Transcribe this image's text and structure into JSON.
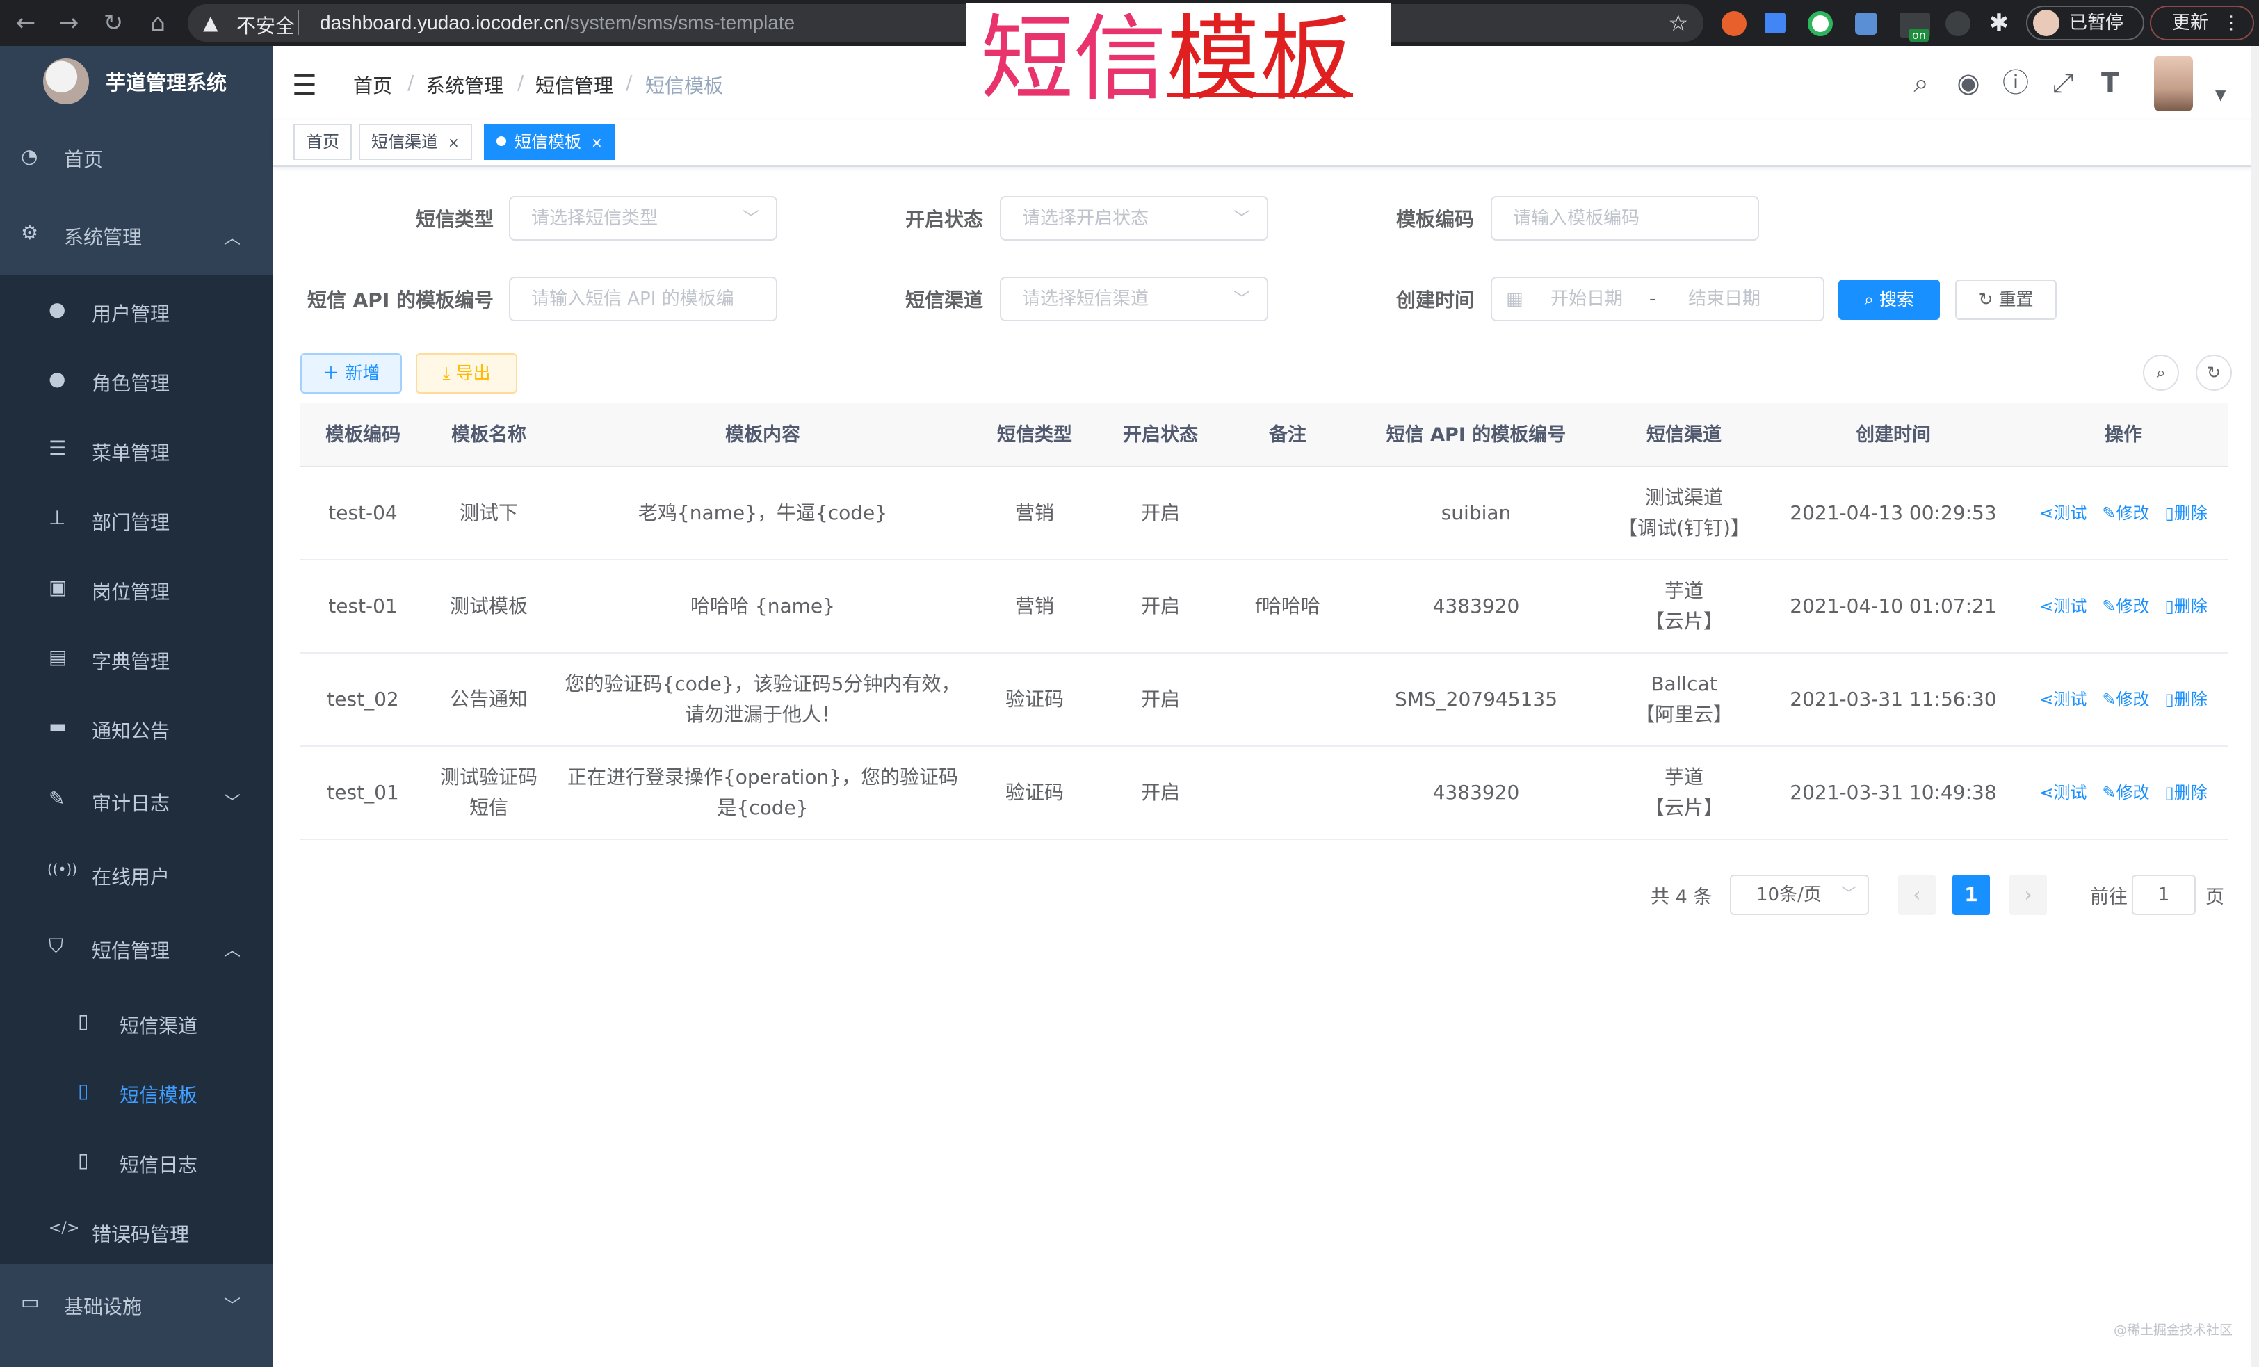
{
  "browser": {
    "insecure_label": "不安全",
    "url_host": "dashboard.yudao.iocoder.cn",
    "url_path": "/system/sms/sms-template",
    "paused_label": "已暂停",
    "update_label": "更新",
    "ext_badge": "on"
  },
  "overlay_title": {
    "part1": "短信",
    "part2": "模板"
  },
  "app": {
    "title": "芋道管理系统"
  },
  "sidebar": {
    "home": "首页",
    "system": "系统管理",
    "items": [
      {
        "label": "用户管理",
        "icon": "user-icon"
      },
      {
        "label": "角色管理",
        "icon": "peoples-icon"
      },
      {
        "label": "菜单管理",
        "icon": "tree-table-icon"
      },
      {
        "label": "部门管理",
        "icon": "tree-icon"
      },
      {
        "label": "岗位管理",
        "icon": "post-icon"
      },
      {
        "label": "字典管理",
        "icon": "dict-icon"
      },
      {
        "label": "通知公告",
        "icon": "message-icon"
      },
      {
        "label": "审计日志",
        "icon": "log-icon"
      },
      {
        "label": "在线用户",
        "icon": "online-icon"
      },
      {
        "label": "短信管理",
        "icon": "validCode-icon"
      }
    ],
    "sms_children": [
      {
        "label": "短信渠道"
      },
      {
        "label": "短信模板"
      },
      {
        "label": "短信日志"
      }
    ],
    "error_code": "错误码管理",
    "infra": "基础设施"
  },
  "breadcrumb": [
    "首页",
    "系统管理",
    "短信管理",
    "短信模板"
  ],
  "tags": [
    {
      "label": "首页"
    },
    {
      "label": "短信渠道",
      "close": "×"
    },
    {
      "label": "短信模板",
      "close": "×"
    }
  ],
  "search": {
    "type_label": "短信类型",
    "type_placeholder": "请选择短信类型",
    "status_label": "开启状态",
    "status_placeholder": "请选择开启状态",
    "code_label": "模板编码",
    "code_placeholder": "请输入模板编码",
    "api_label": "短信 API 的模板编号",
    "api_placeholder": "请输入短信 API 的模板编",
    "channel_label": "短信渠道",
    "channel_placeholder": "请选择短信渠道",
    "time_label": "创建时间",
    "start_placeholder": "开始日期",
    "range_sep": "-",
    "end_placeholder": "结束日期",
    "search_btn": "搜索",
    "reset_btn": "重置"
  },
  "toolbar": {
    "add": "新增",
    "export": "导出"
  },
  "table": {
    "columns": [
      "模板编码",
      "模板名称",
      "模板内容",
      "短信类型",
      "开启状态",
      "备注",
      "短信 API 的模板编号",
      "短信渠道",
      "创建时间",
      "操作"
    ],
    "rows": [
      {
        "code": "test-04",
        "name": "测试下",
        "content": "老鸡{name}，牛逼{code}",
        "type": "营销",
        "status": "开启",
        "remark": "",
        "api": "suibian",
        "channel": "测试渠道\n【调试(钉钉)】",
        "time": "2021-04-13 00:29:53"
      },
      {
        "code": "test-01",
        "name": "测试模板",
        "content": "哈哈哈 {name}",
        "type": "营销",
        "status": "开启",
        "remark": "f哈哈哈",
        "api": "4383920",
        "channel": "芋道\n【云片】",
        "time": "2021-04-10 01:07:21"
      },
      {
        "code": "test_02",
        "name": "公告通知",
        "content": "您的验证码{code}，该验证码5分钟内有效，\n请勿泄漏于他人！",
        "type": "验证码",
        "status": "开启",
        "remark": "",
        "api": "SMS_207945135",
        "channel": "Ballcat\n【阿里云】",
        "time": "2021-03-31 11:56:30"
      },
      {
        "code": "test_01",
        "name": "测试验证码\n短信",
        "content": "正在进行登录操作{operation}，您的验证码\n是{code}",
        "type": "验证码",
        "status": "开启",
        "remark": "",
        "api": "4383920",
        "channel": "芋道\n【云片】",
        "time": "2021-03-31 10:49:38"
      }
    ],
    "ops": {
      "test": "测试",
      "edit": "修改",
      "delete": "删除"
    }
  },
  "pagination": {
    "total": "共 4 条",
    "page_size": "10条/页",
    "current": "1",
    "goto_prefix": "前往",
    "goto_value": "1",
    "goto_suffix": "页"
  },
  "watermark": "@稀土掘金技术社区",
  "colors": {
    "primary": "#1890ff",
    "sidebar": "#304156",
    "submenu": "#1f2d3d",
    "overlay_pink": "#e8336d"
  }
}
